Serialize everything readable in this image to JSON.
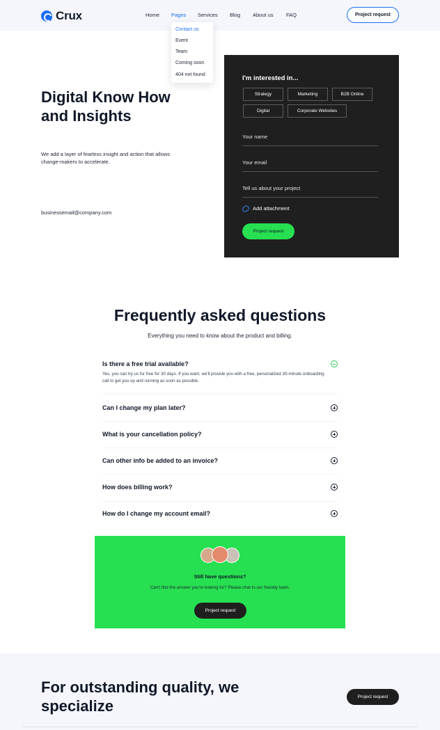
{
  "brand": {
    "name": "Crux",
    "accent": "#1a6df2",
    "green": "#27e051"
  },
  "nav": {
    "items": [
      "Home",
      "Pages",
      "Services",
      "Blog",
      "About us",
      "FAQ"
    ],
    "active": "Pages",
    "cta_label": "Project request"
  },
  "dropdown": {
    "items": [
      "Contact us",
      "Event",
      "Team",
      "Coming soon",
      "404 not found"
    ]
  },
  "hero": {
    "title": "Digital Know How and Insights",
    "subtitle": "We add a layer of fearless insight and action that allows change-makers to accelerate.",
    "email": "businessemail@company.com"
  },
  "form": {
    "heading": "I'm interested in...",
    "chips": [
      "Strategy",
      "Marketing",
      "B2B Online",
      "Digital",
      "Corporate Websites"
    ],
    "fields": [
      "Your name",
      "Your email",
      "Tell us about your project"
    ],
    "attach_label": "Add attachment",
    "submit_label": "Project request"
  },
  "faq": {
    "title": "Frequently asked questions",
    "subtitle": "Everything you need to know about the product and billing.",
    "items": [
      {
        "q": "Is there a free trial available?",
        "a": "Yes, you can try us for free for 30 days. If you want, we'll provide you with a free, personalized 30-minute onboarding call to get you up and running as soon as possible.",
        "open": true
      },
      {
        "q": "Can I change my plan later?",
        "a": "",
        "open": false
      },
      {
        "q": "What is your cancellation policy?",
        "a": "",
        "open": false
      },
      {
        "q": "Can other info be added to an invoice?",
        "a": "",
        "open": false
      },
      {
        "q": "How does billing work?",
        "a": "",
        "open": false
      },
      {
        "q": "How do I change my account email?",
        "a": "",
        "open": false
      }
    ]
  },
  "cta": {
    "title": "Still have questions?",
    "subtitle": "Can't find the answer you're looking for? Please chat to our friendly team.",
    "button_label": "Project request"
  },
  "bottom": {
    "title": "For outstanding quality, we specialize",
    "button_label": "Project request"
  }
}
